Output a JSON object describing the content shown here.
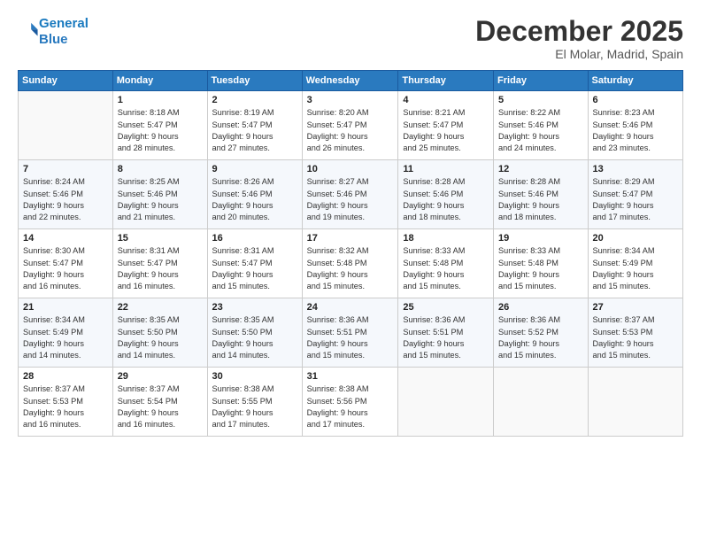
{
  "header": {
    "logo_line1": "General",
    "logo_line2": "Blue",
    "month": "December 2025",
    "location": "El Molar, Madrid, Spain"
  },
  "weekdays": [
    "Sunday",
    "Monday",
    "Tuesday",
    "Wednesday",
    "Thursday",
    "Friday",
    "Saturday"
  ],
  "weeks": [
    [
      {
        "day": "",
        "info": ""
      },
      {
        "day": "1",
        "info": "Sunrise: 8:18 AM\nSunset: 5:47 PM\nDaylight: 9 hours\nand 28 minutes."
      },
      {
        "day": "2",
        "info": "Sunrise: 8:19 AM\nSunset: 5:47 PM\nDaylight: 9 hours\nand 27 minutes."
      },
      {
        "day": "3",
        "info": "Sunrise: 8:20 AM\nSunset: 5:47 PM\nDaylight: 9 hours\nand 26 minutes."
      },
      {
        "day": "4",
        "info": "Sunrise: 8:21 AM\nSunset: 5:47 PM\nDaylight: 9 hours\nand 25 minutes."
      },
      {
        "day": "5",
        "info": "Sunrise: 8:22 AM\nSunset: 5:46 PM\nDaylight: 9 hours\nand 24 minutes."
      },
      {
        "day": "6",
        "info": "Sunrise: 8:23 AM\nSunset: 5:46 PM\nDaylight: 9 hours\nand 23 minutes."
      }
    ],
    [
      {
        "day": "7",
        "info": "Sunrise: 8:24 AM\nSunset: 5:46 PM\nDaylight: 9 hours\nand 22 minutes."
      },
      {
        "day": "8",
        "info": "Sunrise: 8:25 AM\nSunset: 5:46 PM\nDaylight: 9 hours\nand 21 minutes."
      },
      {
        "day": "9",
        "info": "Sunrise: 8:26 AM\nSunset: 5:46 PM\nDaylight: 9 hours\nand 20 minutes."
      },
      {
        "day": "10",
        "info": "Sunrise: 8:27 AM\nSunset: 5:46 PM\nDaylight: 9 hours\nand 19 minutes."
      },
      {
        "day": "11",
        "info": "Sunrise: 8:28 AM\nSunset: 5:46 PM\nDaylight: 9 hours\nand 18 minutes."
      },
      {
        "day": "12",
        "info": "Sunrise: 8:28 AM\nSunset: 5:46 PM\nDaylight: 9 hours\nand 18 minutes."
      },
      {
        "day": "13",
        "info": "Sunrise: 8:29 AM\nSunset: 5:47 PM\nDaylight: 9 hours\nand 17 minutes."
      }
    ],
    [
      {
        "day": "14",
        "info": "Sunrise: 8:30 AM\nSunset: 5:47 PM\nDaylight: 9 hours\nand 16 minutes."
      },
      {
        "day": "15",
        "info": "Sunrise: 8:31 AM\nSunset: 5:47 PM\nDaylight: 9 hours\nand 16 minutes."
      },
      {
        "day": "16",
        "info": "Sunrise: 8:31 AM\nSunset: 5:47 PM\nDaylight: 9 hours\nand 15 minutes."
      },
      {
        "day": "17",
        "info": "Sunrise: 8:32 AM\nSunset: 5:48 PM\nDaylight: 9 hours\nand 15 minutes."
      },
      {
        "day": "18",
        "info": "Sunrise: 8:33 AM\nSunset: 5:48 PM\nDaylight: 9 hours\nand 15 minutes."
      },
      {
        "day": "19",
        "info": "Sunrise: 8:33 AM\nSunset: 5:48 PM\nDaylight: 9 hours\nand 15 minutes."
      },
      {
        "day": "20",
        "info": "Sunrise: 8:34 AM\nSunset: 5:49 PM\nDaylight: 9 hours\nand 15 minutes."
      }
    ],
    [
      {
        "day": "21",
        "info": "Sunrise: 8:34 AM\nSunset: 5:49 PM\nDaylight: 9 hours\nand 14 minutes."
      },
      {
        "day": "22",
        "info": "Sunrise: 8:35 AM\nSunset: 5:50 PM\nDaylight: 9 hours\nand 14 minutes."
      },
      {
        "day": "23",
        "info": "Sunrise: 8:35 AM\nSunset: 5:50 PM\nDaylight: 9 hours\nand 14 minutes."
      },
      {
        "day": "24",
        "info": "Sunrise: 8:36 AM\nSunset: 5:51 PM\nDaylight: 9 hours\nand 15 minutes."
      },
      {
        "day": "25",
        "info": "Sunrise: 8:36 AM\nSunset: 5:51 PM\nDaylight: 9 hours\nand 15 minutes."
      },
      {
        "day": "26",
        "info": "Sunrise: 8:36 AM\nSunset: 5:52 PM\nDaylight: 9 hours\nand 15 minutes."
      },
      {
        "day": "27",
        "info": "Sunrise: 8:37 AM\nSunset: 5:53 PM\nDaylight: 9 hours\nand 15 minutes."
      }
    ],
    [
      {
        "day": "28",
        "info": "Sunrise: 8:37 AM\nSunset: 5:53 PM\nDaylight: 9 hours\nand 16 minutes."
      },
      {
        "day": "29",
        "info": "Sunrise: 8:37 AM\nSunset: 5:54 PM\nDaylight: 9 hours\nand 16 minutes."
      },
      {
        "day": "30",
        "info": "Sunrise: 8:38 AM\nSunset: 5:55 PM\nDaylight: 9 hours\nand 17 minutes."
      },
      {
        "day": "31",
        "info": "Sunrise: 8:38 AM\nSunset: 5:56 PM\nDaylight: 9 hours\nand 17 minutes."
      },
      {
        "day": "",
        "info": ""
      },
      {
        "day": "",
        "info": ""
      },
      {
        "day": "",
        "info": ""
      }
    ]
  ]
}
